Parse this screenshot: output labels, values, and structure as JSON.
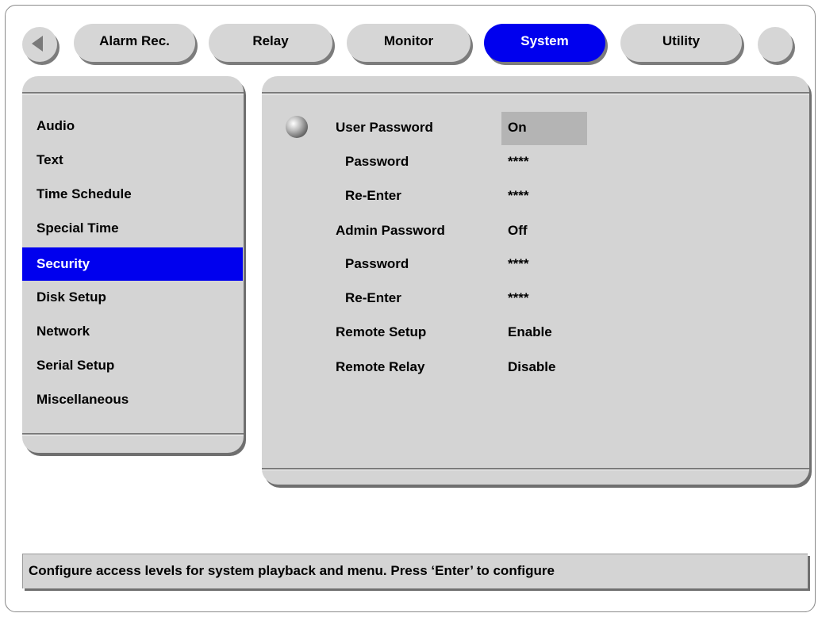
{
  "tabs": [
    {
      "label": "Alarm Rec."
    },
    {
      "label": "Relay"
    },
    {
      "label": "Monitor"
    },
    {
      "label": "System",
      "active": true
    },
    {
      "label": "Utility"
    }
  ],
  "sidebar": {
    "items": [
      {
        "label": "Audio"
      },
      {
        "label": "Text"
      },
      {
        "label": "Time Schedule"
      },
      {
        "label": "Special Time"
      },
      {
        "label": "Security",
        "selected": true
      },
      {
        "label": "Disk Setup"
      },
      {
        "label": "Network"
      },
      {
        "label": "Serial Setup"
      },
      {
        "label": "Miscellaneous"
      }
    ]
  },
  "settings": {
    "rows": [
      {
        "label": "User Password",
        "value": "On"
      },
      {
        "label": "Password",
        "value": "****"
      },
      {
        "label": "Re-Enter",
        "value": "****"
      },
      {
        "label": "Admin Password",
        "value": "Off"
      },
      {
        "label": "Password",
        "value": "****"
      },
      {
        "label": "Re-Enter",
        "value": "****"
      },
      {
        "label": "Remote Setup",
        "value": "Enable"
      },
      {
        "label": "Remote Relay",
        "value": "Disable"
      }
    ]
  },
  "status_text": "Configure access levels for system playback and menu. Press ‘Enter’ to configure",
  "colors": {
    "accent": "#0000ee",
    "panel": "#d4d4d4",
    "highlight": "#b4b4b4"
  },
  "icons": {
    "prev": "triangle-left-icon",
    "cursor": "sphere-cursor-icon"
  }
}
